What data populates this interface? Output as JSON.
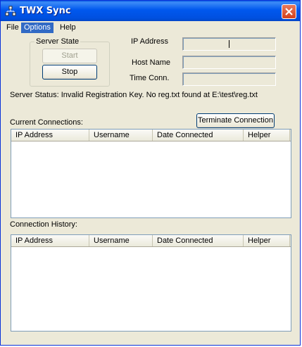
{
  "window": {
    "title": "TWX Sync"
  },
  "menu": {
    "items": [
      "File",
      "Options",
      "Help"
    ]
  },
  "server_state": {
    "label": "Server State",
    "start_label": "Start",
    "stop_label": "Stop"
  },
  "fields": {
    "ip_label": "IP Address",
    "host_label": "Host Name",
    "time_label": "Time Conn.",
    "ip_value": "",
    "host_value": "",
    "time_value": ""
  },
  "status": {
    "text": "Server Status:  Invalid Registration Key. No reg.txt found at E:\\test\\reg.txt"
  },
  "current": {
    "label": "Current Connections:",
    "terminate_label": "Terminate Connection",
    "columns": [
      "IP Address",
      "Username",
      "Date Connected",
      "Helper"
    ],
    "rows": []
  },
  "history": {
    "label": "Connection History:",
    "columns": [
      "IP Address",
      "Username",
      "Date Connected",
      "Helper"
    ],
    "rows": []
  },
  "colors": {
    "title_bar": "#0058ee",
    "menu_highlight": "#316ac5",
    "close_button": "#d5411c",
    "face": "#ece9d8"
  }
}
